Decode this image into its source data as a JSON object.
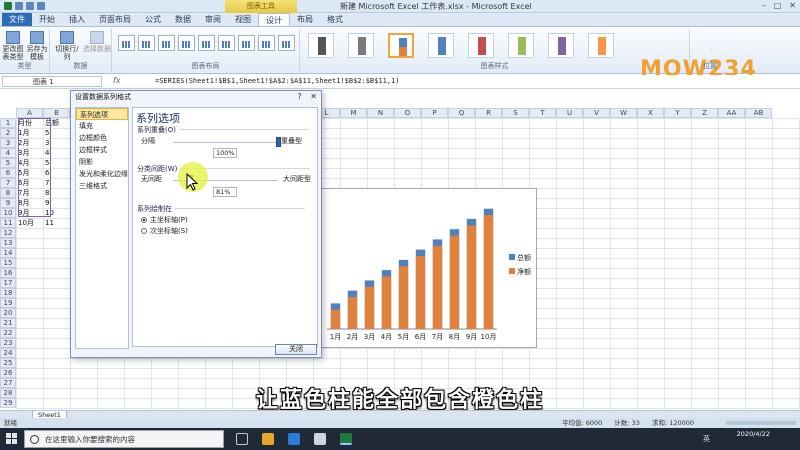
{
  "window": {
    "title": "新建 Microsoft Excel 工作表.xlsx - Microsoft Excel",
    "context_tab": "图表工具"
  },
  "ribbon": {
    "tabs": [
      "文件",
      "开始",
      "插入",
      "页面布局",
      "公式",
      "数据",
      "审阅",
      "视图",
      "设计",
      "布局",
      "格式"
    ],
    "active_tab": "设计",
    "type_group": {
      "change_type": "更改图表类型",
      "save_template": "另存为模板",
      "label": "类型"
    },
    "data_group": {
      "switch": "切换行/列",
      "select": "选择数据",
      "label": "数据"
    },
    "layout_label": "图表布局",
    "styles_label": "图表样式",
    "position_label": "位置",
    "brand": "MOW234"
  },
  "formula_bar": {
    "name_box": "图表 1",
    "fx": "fx",
    "formula": "=SERIES(Sheet1!$B$1,Sheet1!$A$2:$A$11,Sheet1!$B$2:$B$11,1)"
  },
  "sheet": {
    "columns": [
      "A",
      "B",
      "C",
      "D",
      "E",
      "F",
      "G",
      "H",
      "I",
      "J",
      "K",
      "L",
      "M",
      "N",
      "O",
      "P",
      "Q",
      "R",
      "S",
      "T",
      "U",
      "V",
      "W",
      "X",
      "Y",
      "Z",
      "AA",
      "AB"
    ],
    "rows": [
      "1",
      "2",
      "3",
      "4",
      "5",
      "6",
      "7",
      "8",
      "9",
      "10",
      "11",
      "12",
      "13",
      "14",
      "15",
      "16",
      "17",
      "18",
      "19",
      "20",
      "21",
      "22",
      "23",
      "24",
      "25",
      "26",
      "27",
      "28",
      "29"
    ],
    "col_a": [
      "月份",
      "1月",
      "2月",
      "3月",
      "4月",
      "5月",
      "6月",
      "7月",
      "8月",
      "9月",
      "10月"
    ],
    "col_b": [
      "总额",
      "5",
      "3",
      "4",
      "5",
      "6",
      "7",
      "8",
      "9",
      "10",
      "11"
    ],
    "sheet_tab": "Sheet1"
  },
  "dialog": {
    "title": "设置数据系列格式",
    "help": "?",
    "nav": [
      "系列选项",
      "填充",
      "边框颜色",
      "边框样式",
      "阴影",
      "发光和柔化边缘",
      "三维格式"
    ],
    "active_nav": "系列选项",
    "pane_title": "系列选项",
    "overlap": {
      "label": "系列重叠(O)",
      "left": "分隔",
      "right": "重叠型",
      "value": "100%",
      "fraction": 1.0
    },
    "gap": {
      "label": "分类间距(W)",
      "left": "无间距",
      "right": "大间距型",
      "value": "81%",
      "fraction": 0.162
    },
    "axis": {
      "label": "系列绘制在",
      "primary": "主坐标轴(P)",
      "secondary": "次坐标轴(S)",
      "selected": "primary"
    },
    "close": "关闭"
  },
  "chart_data": {
    "type": "bar",
    "categories": [
      "1月",
      "2月",
      "3月",
      "4月",
      "5月",
      "6月",
      "7月",
      "8月",
      "9月",
      "10月"
    ],
    "series": [
      {
        "name": "总额",
        "values": [
          20,
          30,
          38,
          46,
          54,
          62,
          70,
          78,
          86,
          94
        ],
        "color": "#4f81bd"
      },
      {
        "name": "净额",
        "values": [
          15,
          25,
          33,
          41,
          49,
          57,
          65,
          73,
          81,
          89
        ],
        "color": "#e0813e"
      }
    ],
    "ylim": [
      0,
      100
    ],
    "overlap": true,
    "legend": "right",
    "grid": false
  },
  "subtitle": "让蓝色柱能全部包含橙色柱",
  "status": {
    "ready": "就绪",
    "average": "平均值: 6000",
    "count": "计数: 33",
    "sum": "求和: 120000"
  },
  "taskbar": {
    "search_placeholder": "在这里输入你要搜索的内容",
    "date": "2020/4/22",
    "ime": "英"
  }
}
